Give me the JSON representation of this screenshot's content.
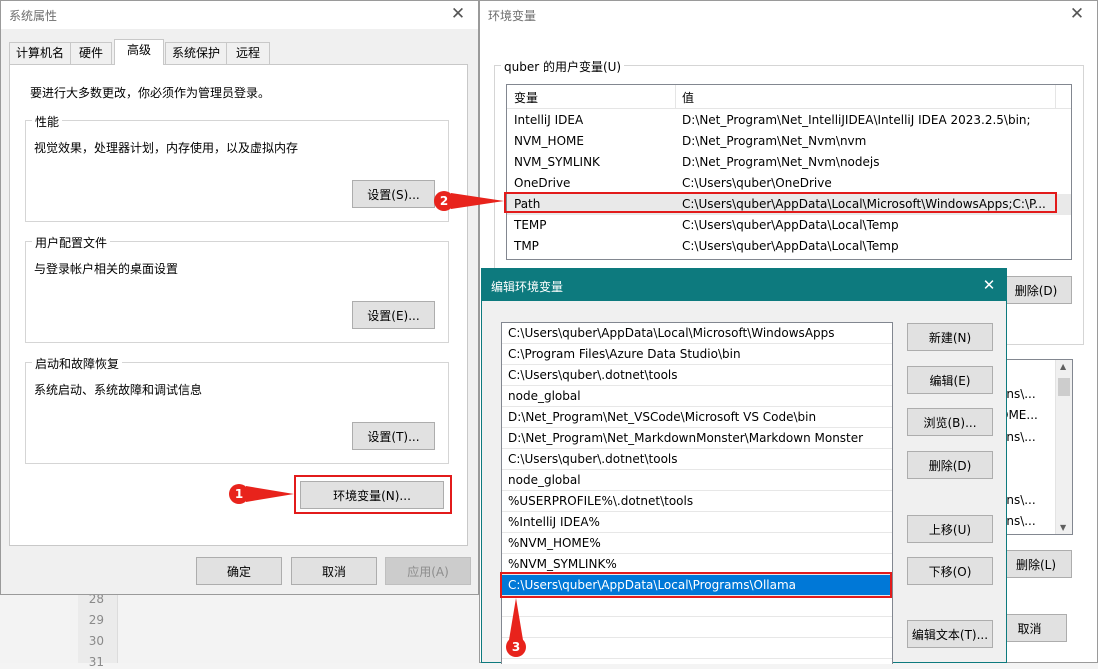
{
  "editor_bg": {
    "line_numbers": [
      "28",
      "29",
      "30",
      "31"
    ]
  },
  "sysprops": {
    "title": "系统属性",
    "tabs": [
      {
        "label": "计算机名"
      },
      {
        "label": "硬件"
      },
      {
        "label": "高级"
      },
      {
        "label": "系统保护"
      },
      {
        "label": "远程"
      }
    ],
    "admin_note": "要进行大多数更改，你必须作为管理员登录。",
    "performance": {
      "label": "性能",
      "desc": "视觉效果，处理器计划，内存使用，以及虚拟内存",
      "button": "设置(S)..."
    },
    "profiles": {
      "label": "用户配置文件",
      "desc": "与登录帐户相关的桌面设置",
      "button": "设置(E)..."
    },
    "startup": {
      "label": "启动和故障恢复",
      "desc": "系统启动、系统故障和调试信息",
      "button": "设置(T)..."
    },
    "env_button": "环境变量(N)...",
    "ok": "确定",
    "cancel": "取消",
    "apply": "应用(A)"
  },
  "envvars": {
    "title": "环境变量",
    "user_group_label": "quber 的用户变量(U)",
    "col_var": "变量",
    "col_val": "值",
    "user_vars": [
      {
        "name": "IntelliJ IDEA",
        "value": "D:\\Net_Program\\Net_IntelliJIDEA\\IntelliJ IDEA 2023.2.5\\bin;"
      },
      {
        "name": "NVM_HOME",
        "value": "D:\\Net_Program\\Net_Nvm\\nvm"
      },
      {
        "name": "NVM_SYMLINK",
        "value": "D:\\Net_Program\\Net_Nvm\\nodejs"
      },
      {
        "name": "OneDrive",
        "value": "C:\\Users\\quber\\OneDrive"
      },
      {
        "name": "Path",
        "value": "C:\\Users\\quber\\AppData\\Local\\Microsoft\\WindowsApps;C:\\P..."
      },
      {
        "name": "TEMP",
        "value": "C:\\Users\\quber\\AppData\\Local\\Temp"
      },
      {
        "name": "TMP",
        "value": "C:\\Users\\quber\\AppData\\Local\\Temp"
      }
    ],
    "delete_user": "删除(D)",
    "sys_partial": [
      "ons\\...",
      "OME...",
      "ons\\...",
      "",
      "ons\\...",
      "ons\\..."
    ],
    "delete_sys": "删除(L)",
    "cancel": "取消"
  },
  "editenv": {
    "title": "编辑环境变量",
    "entries": [
      "C:\\Users\\quber\\AppData\\Local\\Microsoft\\WindowsApps",
      "C:\\Program Files\\Azure Data Studio\\bin",
      "C:\\Users\\quber\\.dotnet\\tools",
      "node_global",
      "D:\\Net_Program\\Net_VSCode\\Microsoft VS Code\\bin",
      "D:\\Net_Program\\Net_MarkdownMonster\\Markdown Monster",
      "C:\\Users\\quber\\.dotnet\\tools",
      "node_global",
      "%USERPROFILE%\\.dotnet\\tools",
      "%IntelliJ IDEA%",
      "%NVM_HOME%",
      "%NVM_SYMLINK%",
      "C:\\Users\\quber\\AppData\\Local\\Programs\\Ollama"
    ],
    "buttons": {
      "new": "新建(N)",
      "edit": "编辑(E)",
      "browse": "浏览(B)...",
      "delete": "删除(D)",
      "up": "上移(U)",
      "down": "下移(O)",
      "edit_text": "编辑文本(T)..."
    }
  },
  "markers": [
    "1",
    "2",
    "3"
  ],
  "colors": {
    "accent_teal": "#0d7a7e",
    "select_blue": "#0078d7",
    "annotation_red": "#e21b1b"
  }
}
